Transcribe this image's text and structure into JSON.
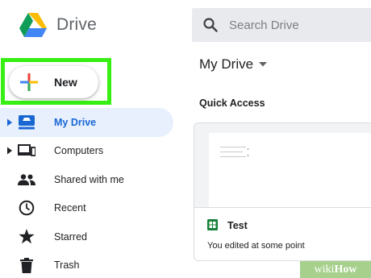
{
  "header": {
    "app_name": "Drive",
    "logo_icon": "google-drive-logo",
    "search": {
      "icon": "search-icon",
      "placeholder": "Search Drive"
    }
  },
  "new_button": {
    "label": "New",
    "icon": "multicolor-plus-icon",
    "highlight_color": "#38ef14"
  },
  "sidebar": {
    "items": [
      {
        "label": "My Drive",
        "icon": "my-drive-icon",
        "active": true,
        "expandable": true
      },
      {
        "label": "Computers",
        "icon": "computers-icon",
        "active": false,
        "expandable": true
      },
      {
        "label": "Shared with me",
        "icon": "shared-people-icon",
        "active": false,
        "expandable": false
      },
      {
        "label": "Recent",
        "icon": "clock-icon",
        "active": false,
        "expandable": false
      },
      {
        "label": "Starred",
        "icon": "star-icon",
        "active": false,
        "expandable": false
      },
      {
        "label": "Trash",
        "icon": "trash-icon",
        "active": false,
        "expandable": false
      }
    ]
  },
  "main": {
    "title": "My Drive",
    "quick_access_label": "Quick Access",
    "files": [
      {
        "name": "Test",
        "meta": "You edited at some point",
        "icon": "sheets-icon"
      }
    ]
  },
  "watermark": {
    "part1": "wiki",
    "part2": "How"
  },
  "colors": {
    "active_bg": "#e8f0fe",
    "active_text": "#1967d2",
    "sheets_green": "#188038",
    "search_bg": "#e8eaed"
  }
}
